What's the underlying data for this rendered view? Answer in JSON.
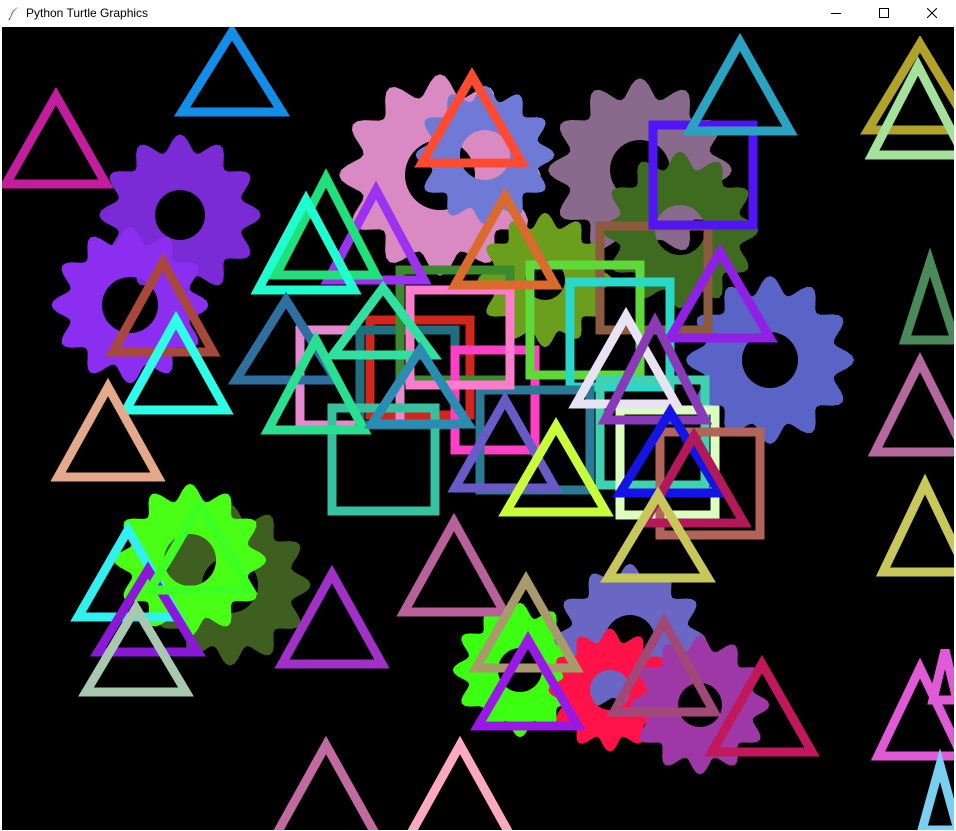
{
  "window": {
    "title": "Python Turtle Graphics",
    "icon": "feather-icon",
    "controls": [
      "minimize-icon",
      "maximize-icon",
      "close-icon"
    ]
  },
  "canvas": {
    "background": "#000000"
  }
}
